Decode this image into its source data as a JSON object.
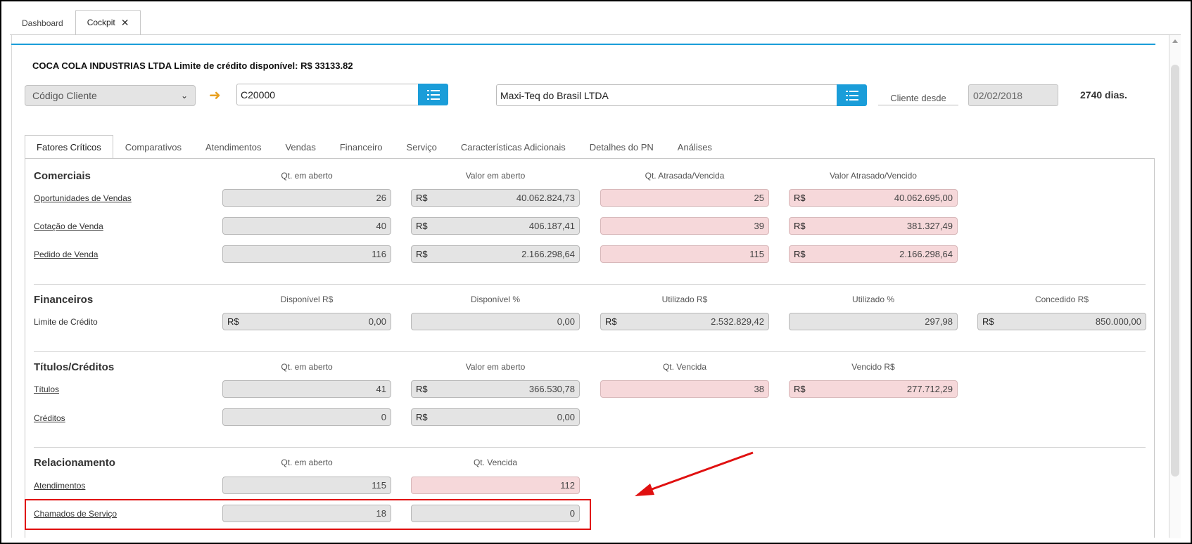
{
  "top_tabs": [
    {
      "label": "Dashboard"
    },
    {
      "label": "Cockpit",
      "close": "✕"
    }
  ],
  "header": {
    "company_line": "COCA COLA INDUSTRIAS LTDA Limite de crédito disponível: R$ 33133.82",
    "select_value": "Código Cliente",
    "client_code": "C20000",
    "client_name": "Maxi-Teq do Brasil LTDA",
    "cliente_desde_label": "Cliente desde",
    "cliente_desde_date": "02/02/2018",
    "dias": "2740 dias."
  },
  "inner_tabs": [
    {
      "label": "Fatores Críticos"
    },
    {
      "label": "Comparativos"
    },
    {
      "label": "Atendimentos"
    },
    {
      "label": "Vendas"
    },
    {
      "label": "Financeiro"
    },
    {
      "label": "Serviço"
    },
    {
      "label": "Características Adicionais"
    },
    {
      "label": "Detalhes do PN"
    },
    {
      "label": "Análises"
    }
  ],
  "currency": "R$",
  "comerciais": {
    "title": "Comerciais",
    "headers": [
      "Qt. em aberto",
      "Valor em aberto",
      "Qt. Atrasada/Vencida",
      "Valor Atrasado/Vencido"
    ],
    "rows": [
      {
        "label": "Oportunidades de Vendas",
        "v": [
          "26",
          "40.062.824,73",
          "25",
          "40.062.695,00"
        ]
      },
      {
        "label": "Cotação de Venda",
        "v": [
          "40",
          "406.187,41",
          "39",
          "381.327,49"
        ]
      },
      {
        "label": "Pedido de Venda",
        "v": [
          "116",
          "2.166.298,64",
          "115",
          "2.166.298,64"
        ]
      }
    ]
  },
  "financeiros": {
    "title": "Financeiros",
    "headers": [
      "Disponível R$",
      "Disponível %",
      "Utilizado R$",
      "Utilizado %",
      "Concedido R$"
    ],
    "rows": [
      {
        "label": "Limite de Crédito",
        "v": [
          "0,00",
          "0,00",
          "2.532.829,42",
          "297,98",
          "850.000,00"
        ]
      }
    ]
  },
  "titulos": {
    "title": "Títulos/Créditos",
    "headers": [
      "Qt. em aberto",
      "Valor em aberto",
      "Qt. Vencida",
      "Vencido R$"
    ],
    "rows": [
      {
        "label": "Títulos",
        "v": [
          "41",
          "366.530,78",
          "38",
          "277.712,29"
        ]
      },
      {
        "label": "Créditos",
        "v": [
          "0",
          "0,00"
        ]
      }
    ]
  },
  "relacionamento": {
    "title": "Relacionamento",
    "headers": [
      "Qt. em aberto",
      "Qt. Vencida"
    ],
    "rows": [
      {
        "label": "Atendimentos",
        "v": [
          "115",
          "112"
        ]
      },
      {
        "label": "Chamados de Serviço",
        "v": [
          "18",
          "0"
        ]
      }
    ]
  },
  "colors": {
    "accent": "#1a9dd9",
    "alert_field": "#f6d8da",
    "annotation": "#e01010",
    "arrow_icon": "#e8a020"
  }
}
